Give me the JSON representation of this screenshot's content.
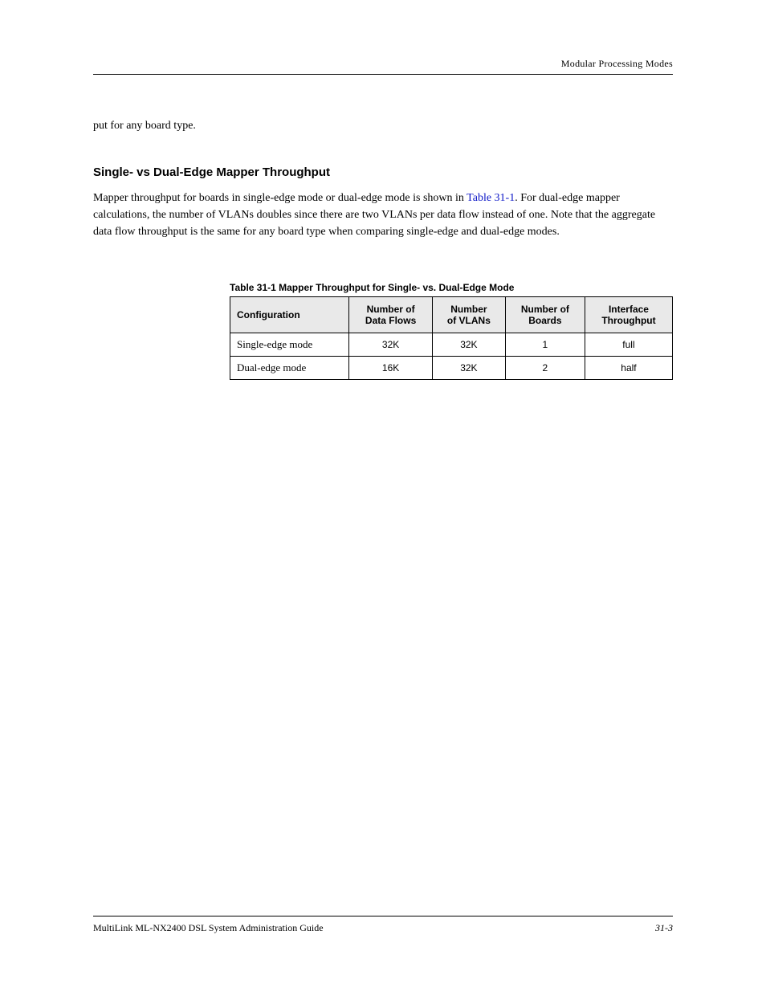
{
  "header": {
    "right": "Modular Processing Modes"
  },
  "body": {
    "intro_short": "put for any board type.",
    "sub_head": "Single- vs Dual-Edge Mapper Throughput",
    "para2_before_link": "Mapper throughput for boards in single-edge mode or dual-edge mode is shown in ",
    "link_text": "Table 31-1",
    "para2_after_link": ". For dual-edge mapper calculations, the number of VLANs doubles since there are two VLANs per data flow instead of one. Note that the aggregate data flow throughput is the same for any board type when comparing single-edge and dual-edge modes."
  },
  "table": {
    "caption": "Table 31-1 Mapper Throughput for Single- vs. Dual-Edge Mode",
    "headers": [
      "Configuration",
      "Number of\nData Flows",
      "Number\nof VLANs",
      "Number of\nBoards",
      "Interface\nThroughput"
    ],
    "rows": [
      [
        "Single-edge mode",
        "32K",
        "32K",
        "1",
        "full"
      ],
      [
        "Dual-edge mode",
        "16K",
        "32K",
        "2",
        "half"
      ]
    ]
  },
  "footer": {
    "left": "MultiLink ML-NX2400 DSL System Administration Guide",
    "right": "31-3"
  }
}
